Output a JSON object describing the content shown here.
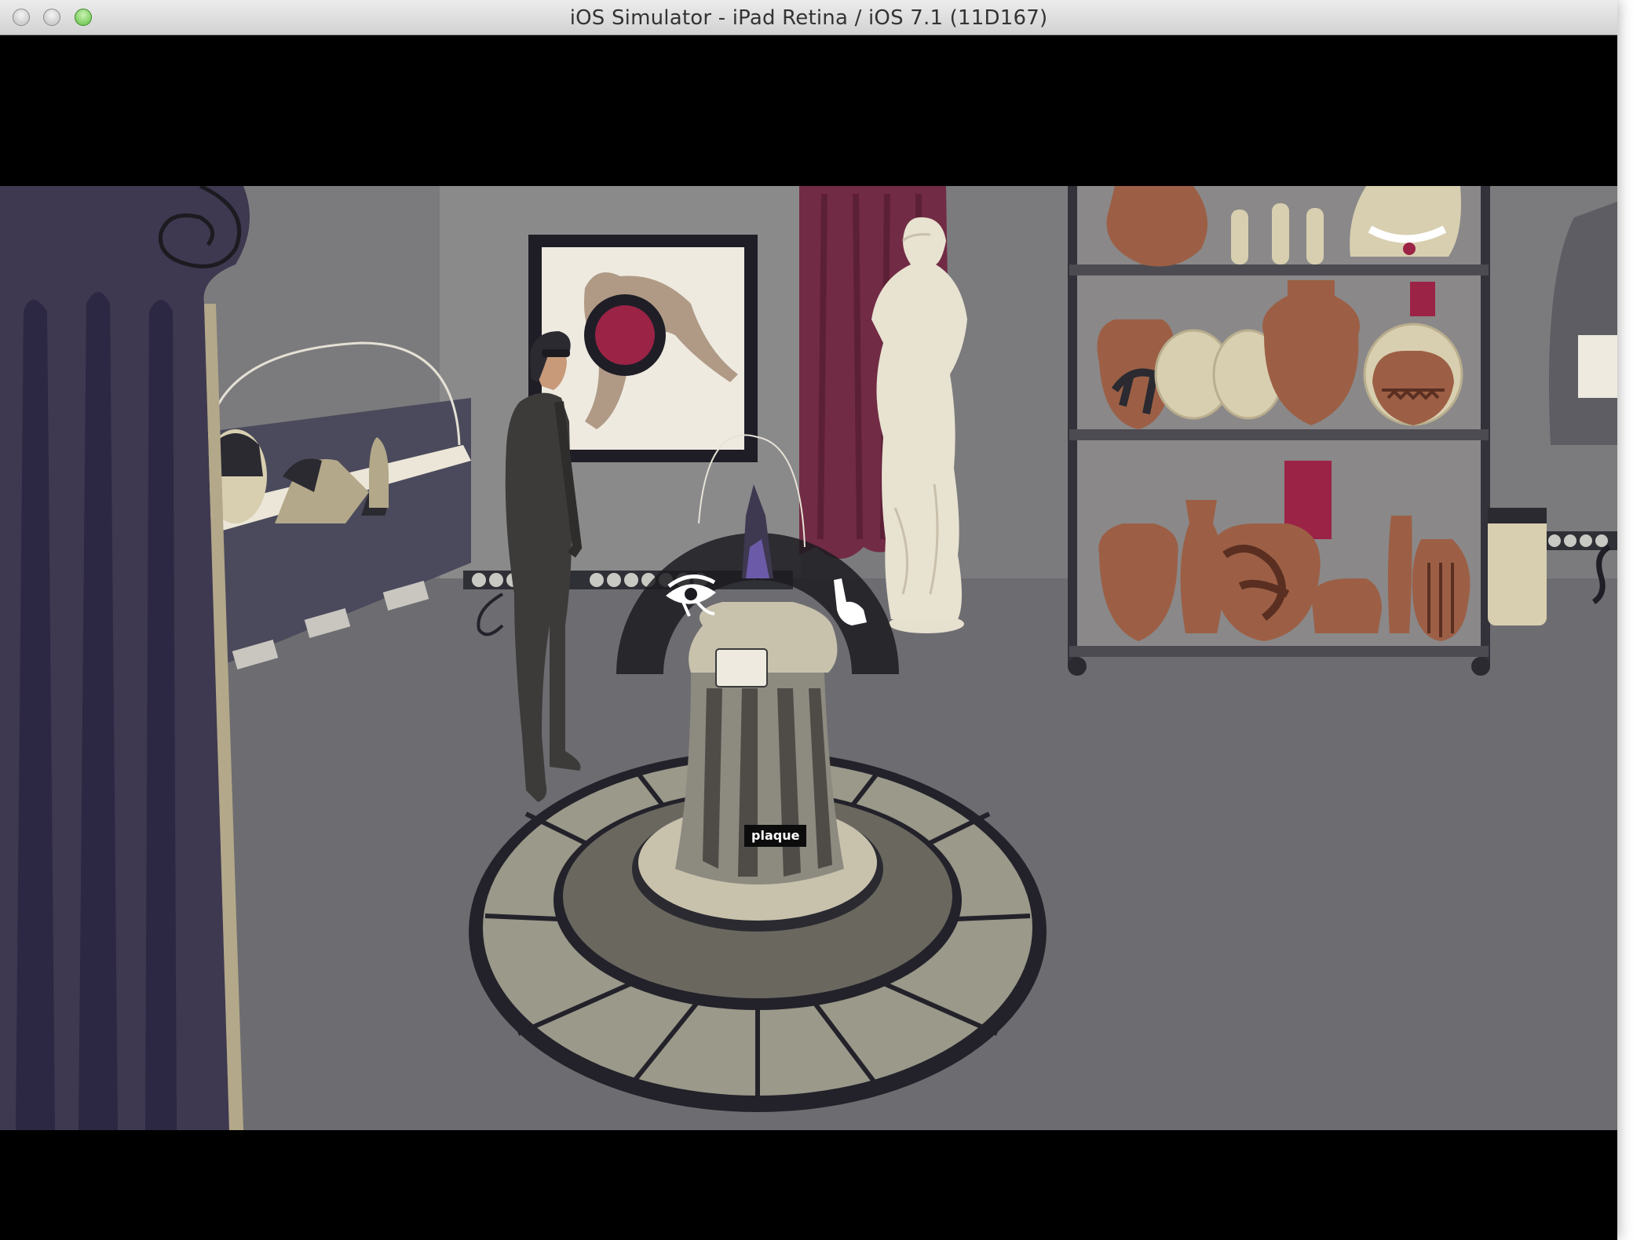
{
  "window": {
    "title": "iOS Simulator - iPad Retina / iOS 7.1 (11D167)",
    "controls": [
      "close",
      "minimize",
      "zoom"
    ]
  },
  "game": {
    "hotspot_label": "plaque",
    "action_menu": {
      "actions": [
        {
          "name": "look",
          "icon": "eye-icon"
        },
        {
          "name": "use",
          "icon": "hand-icon"
        }
      ]
    },
    "inventory": {
      "icon": "briefcase-icon"
    }
  },
  "colors": {
    "background_wall": "#7b7b7d",
    "floor": "#6d6d71",
    "curtain": "#722b45",
    "column": "#3e3850",
    "pottery": "#9c5f45",
    "accent_red": "#9b2346"
  }
}
